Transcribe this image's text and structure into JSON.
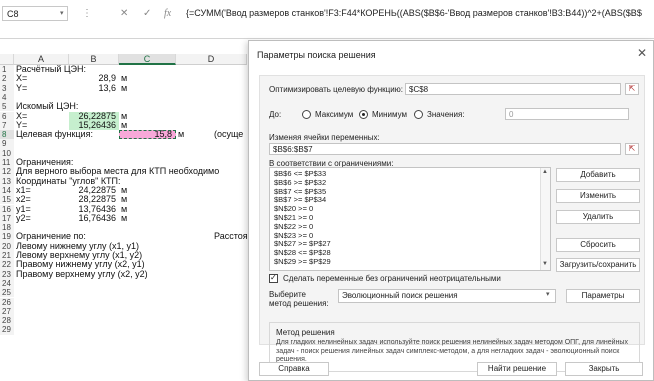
{
  "formula_bar": {
    "name_box": "C8",
    "cancel_icon": "cross-icon",
    "enter_icon": "check-icon",
    "fx": "fx",
    "formula": "{=СУММ('Ввод размеров станков'!F3:F44*КОРЕНЬ((ABS($B$6-'Ввод размеров станков'!B3:B44))^2+(ABS($B$"
  },
  "sheet": {
    "columns": [
      "A",
      "B",
      "C",
      "D"
    ],
    "row_numbers": [
      "1",
      "2",
      "3",
      "4",
      "5",
      "6",
      "7",
      "8",
      "9",
      "10",
      "11",
      "12",
      "13",
      "14",
      "15",
      "16",
      "17",
      "18",
      "19",
      "20",
      "21",
      "22",
      "23",
      "24",
      "25",
      "26",
      "27",
      "28",
      "29"
    ],
    "rows": {
      "r1": {
        "a": "Расчётный ЦЭН:"
      },
      "r2": {
        "a": "X=",
        "b": "28,9",
        "unit": "м"
      },
      "r3": {
        "a": "Y=",
        "b": "13,6",
        "unit": "м"
      },
      "r5": {
        "a": "Искомый ЦЭН:"
      },
      "r6": {
        "a": "X=",
        "b": "26,22875",
        "unit": "м"
      },
      "r7": {
        "a": "Y=",
        "b": "15,26436",
        "unit": "м"
      },
      "r8": {
        "a": "Целевая функция:",
        "c": "15,8",
        "unit": "м",
        "d": "(осуще"
      },
      "r11": {
        "a": "Ограничения:"
      },
      "r12": {
        "a": "Для верного выбора места для КТП необходимо"
      },
      "r13": {
        "a": "Координаты \"углов\" КТП:"
      },
      "r14": {
        "a": "x1=",
        "b": "24,22875",
        "unit": "м"
      },
      "r15": {
        "a": "x2=",
        "b": "28,22875",
        "unit": "м"
      },
      "r16": {
        "a": "y1=",
        "b": "13,76436",
        "unit": "м"
      },
      "r17": {
        "a": "y2=",
        "b": "16,76436",
        "unit": "м"
      },
      "r19": {
        "a": "Ограничение по:",
        "d": "Расстоя"
      },
      "r20": {
        "a": "Левому нижнему углу (x1, y1)"
      },
      "r21": {
        "a": "Левому верхнему углу (x1, y2)"
      },
      "r22": {
        "a": "Правому нижнему углу (x2, y1)"
      },
      "r23": {
        "a": "Правому верхнему углу (x2, y2)"
      }
    }
  },
  "dialog": {
    "title": "Параметры поиска решения",
    "close_icon": "close-icon",
    "objective_label": "Оптимизировать целевую функцию:",
    "objective_value": "$C$8",
    "to_label": "До:",
    "radio_max": "Максимум",
    "radio_min": "Минимум",
    "radio_value": "Значения:",
    "value_input": "0",
    "changing_label": "Изменяя ячейки переменных:",
    "changing_value": "$B$6:$B$7",
    "constraints_label": "В соответствии с ограничениями:",
    "constraints": [
      "$B$6 <= $P$33",
      "$B$6 >= $P$32",
      "$B$7 <= $P$35",
      "$B$7 >= $P$34",
      "$N$20 >= 0",
      "$N$21 >= 0",
      "$N$22 >= 0",
      "$N$23 >= 0",
      "$N$27 >= $P$27",
      "$N$28 <= $P$28",
      "$N$29 >= $P$29"
    ],
    "btn_add": "Добавить",
    "btn_change": "Изменить",
    "btn_delete": "Удалить",
    "btn_reset": "Сбросить",
    "btn_load_save": "Загрузить/сохранить",
    "checkbox_label": "Сделать переменные без ограничений неотрицательными",
    "method_label_1": "Выберите",
    "method_label_2": "метод решения:",
    "method_value": "Эволюционный поиск решения",
    "btn_params": "Параметры",
    "desc_title": "Метод решения",
    "desc_text": "Для гладких нелинейных задач используйте поиск решения нелинейных задач методом ОПГ, для линейных задач - поиск решения линейных задач симплекс-методом, а для негладких задач - эволюционный поиск решения.",
    "btn_help": "Справка",
    "btn_solve": "Найти решение",
    "btn_close": "Закрыть"
  },
  "colors": {
    "accent_green": "#217346",
    "input_green": "#c6efce",
    "target_pink": "#f7a8d8"
  }
}
